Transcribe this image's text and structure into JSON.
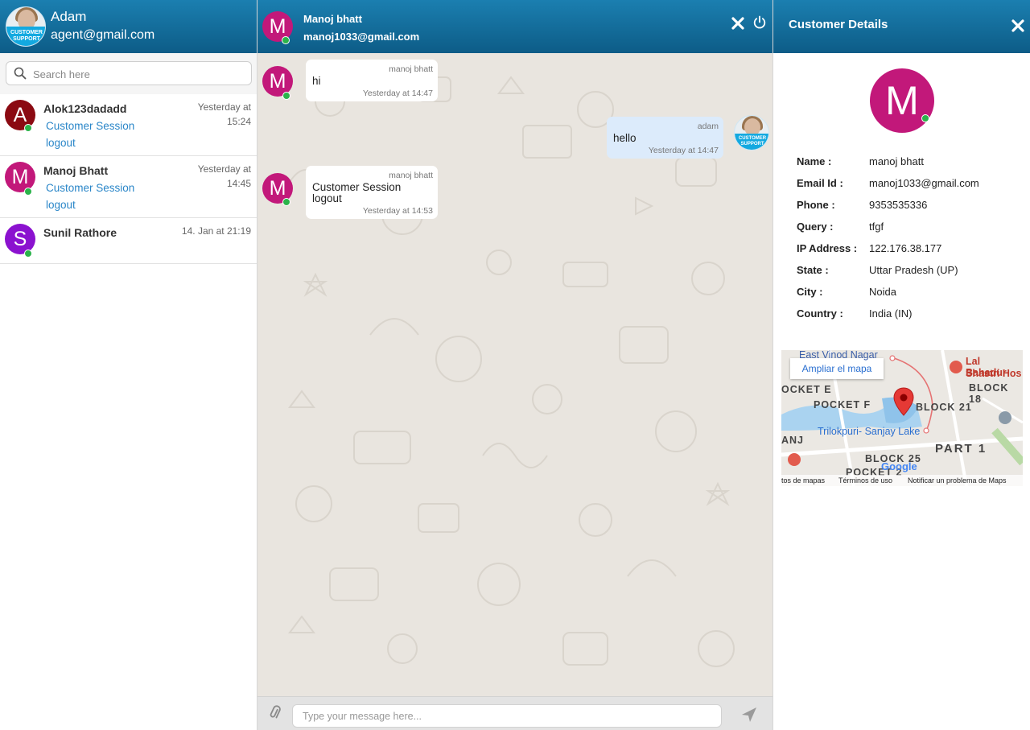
{
  "agent": {
    "name": "Adam",
    "email": "agent@gmail.com",
    "avatar_badge_top": "CUSTOMER",
    "avatar_badge_bottom": "SUPPORT"
  },
  "search": {
    "placeholder": "Search here"
  },
  "conversations": [
    {
      "initial": "A",
      "name": "Alok123dadadd",
      "time_line1": "Yesterday at",
      "time_line2": "15:24",
      "link1": "Customer Session",
      "link2": "logout",
      "color": "#8b0a12"
    },
    {
      "initial": "M",
      "name": "Manoj Bhatt",
      "time_line1": "Yesterday at",
      "time_line2": "14:45",
      "link1": "Customer Session",
      "link2": "logout",
      "color": "#c2187a"
    },
    {
      "initial": "S",
      "name": "Sunil Rathore",
      "time_line1": "14. Jan at 21:19",
      "color": "#8b12cf"
    }
  ],
  "chat": {
    "peer_initial": "M",
    "peer_name": "Manoj bhatt",
    "peer_email": "manoj1033@gmail.com",
    "messages": [
      {
        "sender": "manoj bhatt",
        "text": "hi",
        "time": "Yesterday at 14:47"
      },
      {
        "sender": "adam",
        "text": "hello",
        "time": "Yesterday at 14:47"
      },
      {
        "sender": "manoj bhatt",
        "text_line1": "Customer Session",
        "text_line2": "logout",
        "time": "Yesterday at 14:53"
      }
    ],
    "compose_placeholder": "Type your message here..."
  },
  "details": {
    "title": "Customer Details",
    "avatar_initial": "M",
    "rows": [
      {
        "label": "Name :",
        "value": "manoj bhatt"
      },
      {
        "label": "Email Id :",
        "value": "manoj1033@gmail.com"
      },
      {
        "label": "Phone :",
        "value": "9353535336"
      },
      {
        "label": "Query :",
        "value": "tfgf"
      },
      {
        "label": "IP Address :",
        "value": "122.176.38.177"
      },
      {
        "label": "State :",
        "value": "Uttar Pradesh (UP)"
      },
      {
        "label": "City :",
        "value": "Noida"
      },
      {
        "label": "Country :",
        "value": "India (IN)"
      }
    ],
    "map": {
      "expand_label": "Ampliar el mapa",
      "labels": [
        "East Vinod Nagar",
        "Lal Bahadur",
        "Shastri Hos",
        "OCKET E",
        "POCKET F",
        "BLOCK 21",
        "BLOCK 18",
        "Trilokpuri- Sanjay Lake",
        "PART 1",
        "BLOCK 25",
        "POCKET 2",
        "ANJ"
      ],
      "footer_data": "tos de mapas",
      "footer_terms": "Términos de uso",
      "footer_report": "Notificar un problema de Maps",
      "brand": "Google"
    }
  },
  "colors": {
    "header_top": "#1b7fb0",
    "header_bottom": "#0d5c87",
    "link": "#2a86c8",
    "online": "#2bb34a",
    "outgoing_bubble": "#dcebfb"
  }
}
